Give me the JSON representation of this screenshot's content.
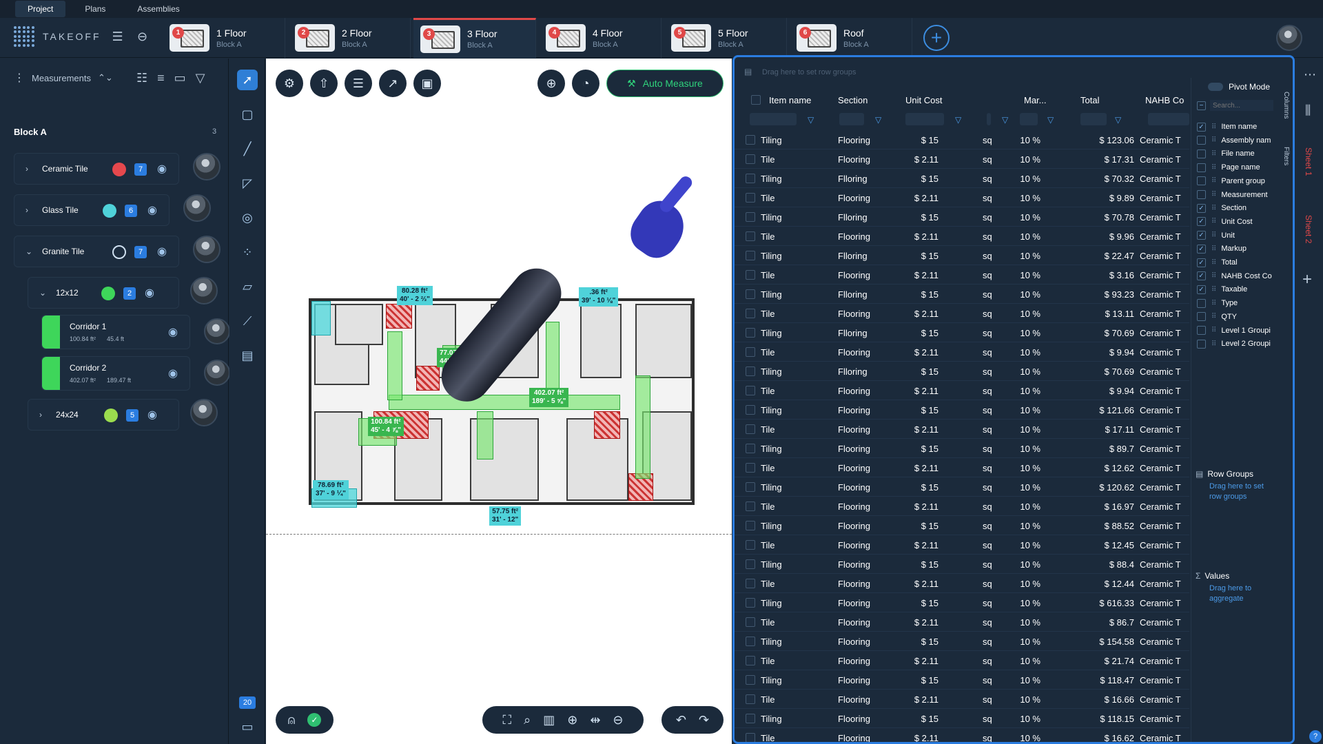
{
  "topnav": {
    "items": [
      "Project",
      "Plans",
      "Assemblies"
    ]
  },
  "brand": {
    "name": "TAKEOFF"
  },
  "floor_tabs": [
    {
      "num": "1",
      "title": "1 Floor",
      "sub": "Block A"
    },
    {
      "num": "2",
      "title": "2 Floor",
      "sub": "Block A"
    },
    {
      "num": "3",
      "title": "3 Floor",
      "sub": "Block A"
    },
    {
      "num": "4",
      "title": "4 Floor",
      "sub": "Block A"
    },
    {
      "num": "5",
      "title": "5 Floor",
      "sub": "Block A"
    },
    {
      "num": "6",
      "title": "Roof",
      "sub": "Block A"
    }
  ],
  "left_panel": {
    "title": "Measurements",
    "block": "Block A",
    "block_count": "3",
    "items": [
      {
        "name": "Ceramic Tile",
        "count": "7",
        "color": "#e5484d"
      },
      {
        "name": "Glass Tile",
        "count": "6",
        "color": "#4fd2d9"
      },
      {
        "name": "Granite Tile",
        "count": "7",
        "color": "transparent"
      },
      {
        "name": "12x12",
        "count": "2",
        "color": "#3ed65a"
      },
      {
        "name": "24x24",
        "count": "5",
        "color": "#9bdc4e"
      }
    ],
    "corridors": [
      {
        "name": "Corridor 1",
        "area": "100.84 ft²",
        "perim": "45.4 ft"
      },
      {
        "name": "Corridor 2",
        "area": "402.07 ft²",
        "perim": "189.47 ft"
      }
    ],
    "page_badge": "20"
  },
  "canvas": {
    "auto_measure": "Auto Measure",
    "labels": [
      {
        "a": "80.28 ft²",
        "b": "40' - 2 ⅔\""
      },
      {
        "a": ".36 ft²",
        "b": "39' - 10 ⅛\""
      },
      {
        "a": "77.07 ft²",
        "b": "44' - 11\""
      },
      {
        "a": "402.07 ft²",
        "b": "189' - 5 ⅝\""
      },
      {
        "a": "100.84 ft²",
        "b": "45' - 4 ⅞\""
      },
      {
        "a": "78.69 ft²",
        "b": "37' - 9 ¼\""
      },
      {
        "a": "57.75 ft²",
        "b": "31' - 12\""
      }
    ]
  },
  "grid": {
    "drag_hint": "Drag here to set row groups",
    "headers": [
      "Item name",
      "Section",
      "Unit Cost",
      "Mar...",
      "Total",
      "NAHB Co"
    ],
    "rows": [
      [
        "Tiling",
        "Flooring",
        "$ 15",
        "sq",
        "10 %",
        "$ 123.06",
        "Ceramic T"
      ],
      [
        "Tile",
        "Flooring",
        "$ 2.11",
        "sq",
        "10 %",
        "$ 17.31",
        "Ceramic T"
      ],
      [
        "Tiling",
        "Flloring",
        "$ 15",
        "sq",
        "10 %",
        "$ 70.32",
        "Ceramic T"
      ],
      [
        "Tile",
        "Flooring",
        "$ 2.11",
        "sq",
        "10 %",
        "$ 9.89",
        "Ceramic T"
      ],
      [
        "Tiling",
        "Flloring",
        "$ 15",
        "sq",
        "10 %",
        "$ 70.78",
        "Ceramic T"
      ],
      [
        "Tile",
        "Flooring",
        "$ 2.11",
        "sq",
        "10 %",
        "$ 9.96",
        "Ceramic T"
      ],
      [
        "Tiling",
        "Flloring",
        "$ 15",
        "sq",
        "10 %",
        "$ 22.47",
        "Ceramic T"
      ],
      [
        "Tile",
        "Flooring",
        "$ 2.11",
        "sq",
        "10 %",
        "$ 3.16",
        "Ceramic T"
      ],
      [
        "Tiling",
        "Flloring",
        "$ 15",
        "sq",
        "10 %",
        "$ 93.23",
        "Ceramic T"
      ],
      [
        "Tile",
        "Flooring",
        "$ 2.11",
        "sq",
        "10 %",
        "$ 13.11",
        "Ceramic T"
      ],
      [
        "Tiling",
        "Flloring",
        "$ 15",
        "sq",
        "10 %",
        "$ 70.69",
        "Ceramic T"
      ],
      [
        "Tile",
        "Flooring",
        "$ 2.11",
        "sq",
        "10 %",
        "$ 9.94",
        "Ceramic T"
      ],
      [
        "Tiling",
        "Flloring",
        "$ 15",
        "sq",
        "10 %",
        "$ 70.69",
        "Ceramic T"
      ],
      [
        "Tile",
        "Flooring",
        "$ 2.11",
        "sq",
        "10 %",
        "$ 9.94",
        "Ceramic T"
      ],
      [
        "Tiling",
        "Flooring",
        "$ 15",
        "sq",
        "10 %",
        "$ 121.66",
        "Ceramic T"
      ],
      [
        "Tile",
        "Flooring",
        "$ 2.11",
        "sq",
        "10 %",
        "$ 17.11",
        "Ceramic T"
      ],
      [
        "Tiling",
        "Flooring",
        "$ 15",
        "sq",
        "10 %",
        "$ 89.7",
        "Ceramic T"
      ],
      [
        "Tile",
        "Flooring",
        "$ 2.11",
        "sq",
        "10 %",
        "$ 12.62",
        "Ceramic T"
      ],
      [
        "Tiling",
        "Flooring",
        "$ 15",
        "sq",
        "10 %",
        "$ 120.62",
        "Ceramic T"
      ],
      [
        "Tile",
        "Flooring",
        "$ 2.11",
        "sq",
        "10 %",
        "$ 16.97",
        "Ceramic T"
      ],
      [
        "Tiling",
        "Flooring",
        "$ 15",
        "sq",
        "10 %",
        "$ 88.52",
        "Ceramic T"
      ],
      [
        "Tile",
        "Flooring",
        "$ 2.11",
        "sq",
        "10 %",
        "$ 12.45",
        "Ceramic T"
      ],
      [
        "Tiling",
        "Flooring",
        "$ 15",
        "sq",
        "10 %",
        "$ 88.4",
        "Ceramic T"
      ],
      [
        "Tile",
        "Flooring",
        "$ 2.11",
        "sq",
        "10 %",
        "$ 12.44",
        "Ceramic T"
      ],
      [
        "Tiling",
        "Flooring",
        "$ 15",
        "sq",
        "10 %",
        "$ 616.33",
        "Ceramic T"
      ],
      [
        "Tile",
        "Flooring",
        "$ 2.11",
        "sq",
        "10 %",
        "$ 86.7",
        "Ceramic T"
      ],
      [
        "Tiling",
        "Flooring",
        "$ 15",
        "sq",
        "10 %",
        "$ 154.58",
        "Ceramic T"
      ],
      [
        "Tile",
        "Flooring",
        "$ 2.11",
        "sq",
        "10 %",
        "$ 21.74",
        "Ceramic T"
      ],
      [
        "Tiling",
        "Flooring",
        "$ 15",
        "sq",
        "10 %",
        "$ 118.47",
        "Ceramic T"
      ],
      [
        "Tile",
        "Flooring",
        "$ 2.11",
        "sq",
        "10 %",
        "$ 16.66",
        "Ceramic T"
      ],
      [
        "Tiling",
        "Flooring",
        "$ 15",
        "sq",
        "10 %",
        "$ 118.15",
        "Ceramic T"
      ],
      [
        "Tile",
        "Flooring",
        "$ 2.11",
        "sq",
        "10 %",
        "$ 16.62",
        "Ceramic T"
      ]
    ],
    "side": {
      "pivot_mode": "Pivot Mode",
      "search_placeholder": "Search...",
      "columns": [
        {
          "name": "Item name",
          "checked": true
        },
        {
          "name": "Assembly nam",
          "checked": false
        },
        {
          "name": "File name",
          "checked": false
        },
        {
          "name": "Page name",
          "checked": false
        },
        {
          "name": "Parent group",
          "checked": false
        },
        {
          "name": "Measurement",
          "checked": false
        },
        {
          "name": "Section",
          "checked": true
        },
        {
          "name": "Unit Cost",
          "checked": true
        },
        {
          "name": "Unit",
          "checked": true
        },
        {
          "name": "Markup",
          "checked": true
        },
        {
          "name": "Total",
          "checked": true
        },
        {
          "name": "NAHB Cost Co",
          "checked": true
        },
        {
          "name": "Taxable",
          "checked": true
        },
        {
          "name": "Type",
          "checked": false
        },
        {
          "name": "QTY",
          "checked": false
        },
        {
          "name": "Level 1 Groupi",
          "checked": false
        },
        {
          "name": "Level 2 Groupi",
          "checked": false
        }
      ],
      "row_groups_title": "Row Groups",
      "row_groups_hint": "Drag here to set row groups",
      "values_title": "Values",
      "values_hint": "Drag here to aggregate",
      "vtab_columns": "Columns",
      "vtab_filters": "Filters"
    }
  },
  "right_strip": {
    "sheet1": "Sheet 1",
    "sheet2": "Sheet 2"
  },
  "colors": {
    "accent": "#2b7de0",
    "active_tab": "#e04848",
    "green": "#3ed65a"
  }
}
